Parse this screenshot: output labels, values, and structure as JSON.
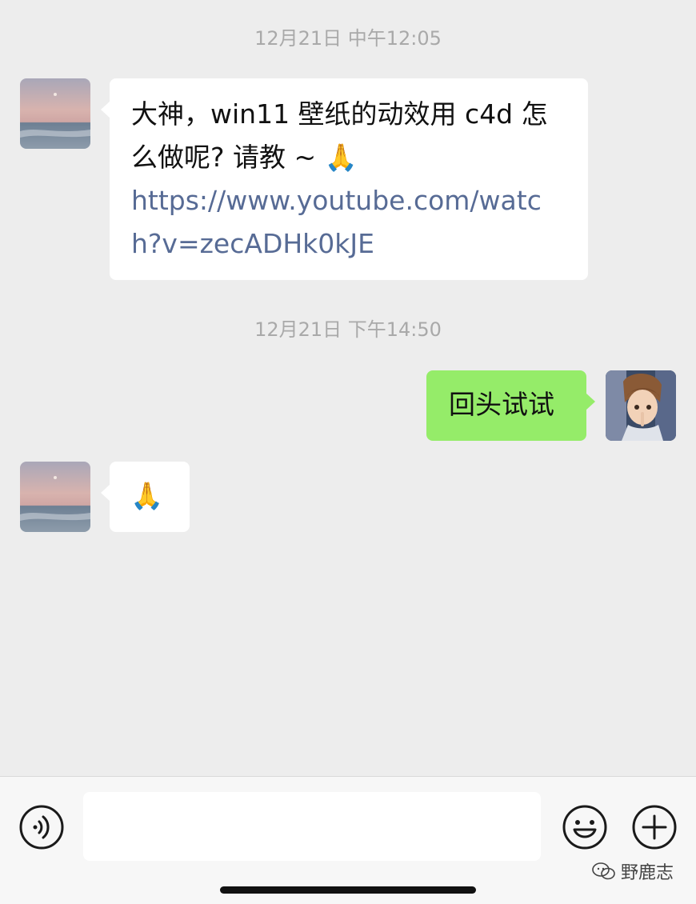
{
  "chat": {
    "timestamp_1": "12月21日 中午12:05",
    "message_1": {
      "text": "大神，win11 壁纸的动效用 c4d 怎么做呢? 请教 ~",
      "emoji": "🙏",
      "link": "https://www.youtube.com/watch?v=zecADHk0kJE"
    },
    "timestamp_2": "12月21日 下午14:50",
    "message_2": {
      "text": "回头试试"
    },
    "message_3": {
      "emoji": "🙏"
    }
  },
  "input_bar": {
    "voice_icon": "voice-icon",
    "emoji_icon": "emoji-icon",
    "plus_icon": "plus-icon"
  },
  "watermark": {
    "text": "野鹿志"
  },
  "colors": {
    "background": "#ededed",
    "incoming_bubble": "#ffffff",
    "outgoing_bubble": "#95ec69",
    "link": "#576b95",
    "timestamp": "#a9a9a9"
  }
}
